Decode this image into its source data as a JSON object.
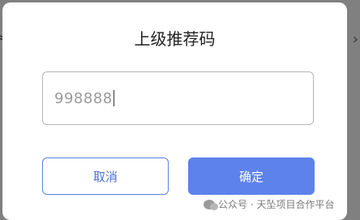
{
  "backdrop": {
    "left_fragment": "≈",
    "right_glyph": "chevron-right-icon"
  },
  "dialog": {
    "title": "上级推荐码",
    "input": {
      "value": "998888"
    },
    "cancel_label": "取消",
    "confirm_label": "确定"
  },
  "watermark": {
    "icon": "wechat-icon",
    "text": "公众号 · 天坠项目合作平台"
  },
  "colors": {
    "accent": "#5d82ea",
    "overlay": "#808080",
    "input_border": "#b6b6b6"
  }
}
